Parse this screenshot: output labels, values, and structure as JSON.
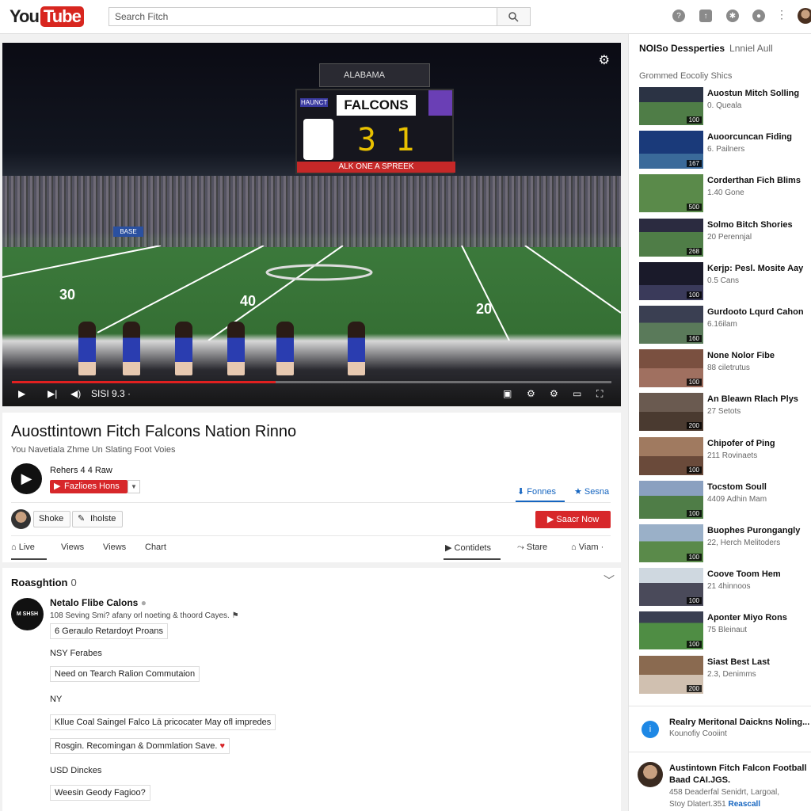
{
  "header": {
    "logo_you": "You",
    "logo_tube": "Tube",
    "search_placeholder": "Search Fitch"
  },
  "player": {
    "scoreboard_title": "FALCONS",
    "scoreboard_score": "3 1",
    "scoreboard_band": "ALK ONE A SPREEK",
    "scoreboard_top": "ALABAMA",
    "scoreboard_left": "HAUNCT",
    "yard_left": "30",
    "yard_mid": "40",
    "yard_right": "20",
    "banner_text": "BASE",
    "progress": 0.44,
    "time_label": "SISI 9.3 ·"
  },
  "video": {
    "title": "Auosttintown Fitch Falcons Nation Rinno",
    "subtitle": "You Navetiala Zhme Un Slating Foot Voies",
    "channel": "Rehers 4 4 Raw",
    "subscribe": "Fazlioes Hons",
    "like_label": "Fonnes",
    "dislike_label": "Sesna",
    "shake_label": "Shoke",
    "hoste_label": "Iholste",
    "share_now": "Saacr Now",
    "tabs": [
      "Live",
      "Views",
      "Views",
      "Chart"
    ],
    "right_tabs": [
      "Contidets",
      "Stare",
      "Viam ·"
    ]
  },
  "comments": {
    "heading": "Roasghtion",
    "count": "0",
    "avatar_text": "M SHSH",
    "author": "Netalo Flibe Calons",
    "text": "108 Seving Smi? afany orl noeting & thoord Cayes.",
    "reply_box": "6 Geraulo Retardoyt Proans",
    "label1": "NSY Ferabes",
    "box1": "Need on Tearch Ralion Commutaion",
    "label2": "NY",
    "box2": "Kllue Coal Saingel Falco Lā pricocater May ofl impredes",
    "box3": "Rosgin. Recomingan & Dommlation Save.",
    "label3": "USD Dinckes",
    "box4": "Weesin Geody Fagioo?"
  },
  "sidebar": {
    "header_title": "NOISo Dessperties",
    "header_sub": "Lnniel Aull",
    "subtitle": "Grommed Eocoliy Shics",
    "items": [
      {
        "title": "Auostun Mitch Solling",
        "sub": "0. Queala",
        "dur": "100"
      },
      {
        "title": "Auoorcuncan Fiding",
        "sub": "6. Pailners",
        "dur": "167"
      },
      {
        "title": "Corderthan Fich Blims",
        "sub": "1.40 Gone",
        "dur": "500"
      },
      {
        "title": "Solmo Bitch Shories",
        "sub": "20 Perennjal",
        "dur": "268"
      },
      {
        "title": "Kerjp: Pesl. Mosite Aay",
        "sub": "0.5 Cans",
        "dur": "100"
      },
      {
        "title": "Gurdooto Lqurd Cahon",
        "sub": "6.16ilam",
        "dur": "160"
      },
      {
        "title": "None Nolor Fibe",
        "sub": "88 ciletrutus",
        "dur": "100"
      },
      {
        "title": "An Bleawn Rlach Plys",
        "sub": "27 Setots",
        "dur": "200"
      },
      {
        "title": "Chipofer of Ping",
        "sub": "211 Rovinaets",
        "dur": "100"
      },
      {
        "title": "Tocstom Soull",
        "sub": "4409 Adhin Mam",
        "dur": "100"
      },
      {
        "title": "Buophes Purongangly",
        "sub": "22, Herch Melitoders",
        "dur": "100"
      },
      {
        "title": "Coove Toom Hem",
        "sub": "21 4hinnoos",
        "dur": "100"
      },
      {
        "title": "Aponter Miyo Rons",
        "sub": "75 Bleinaut",
        "dur": "100"
      },
      {
        "title": "Siast Best Last",
        "sub": "2.3, Denimms",
        "dur": "200"
      }
    ],
    "bottom1_title": "Realry Meritonal Daickns Noling...",
    "bottom1_sub": "Kounofiy Cooiint",
    "bottom2_title": "Austintown Fitch Falcon Football",
    "bottom2_title2": "Baad CAI.JGS.",
    "bottom2_sub": "458 Deaderfal Senidrt, Largoal,",
    "bottom2_sub2": "Stoy Dlatert.351",
    "bottom2_link": "Reascall"
  },
  "colors": {
    "brand_red": "#d7272a",
    "link_blue": "#1565c0"
  }
}
